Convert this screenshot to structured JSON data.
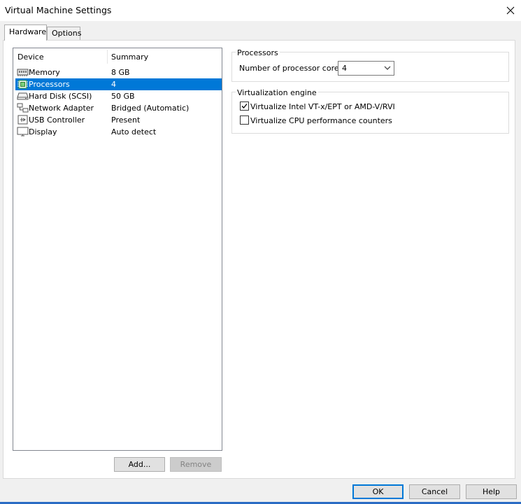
{
  "window": {
    "title": "Virtual Machine Settings"
  },
  "tabs": [
    {
      "label": "Hardware",
      "active": true
    },
    {
      "label": "Options",
      "active": false
    }
  ],
  "device_list": {
    "columns": [
      "Device",
      "Summary"
    ],
    "rows": [
      {
        "icon": "memory-icon",
        "device": "Memory",
        "summary": "8 GB",
        "selected": false
      },
      {
        "icon": "processor-icon",
        "device": "Processors",
        "summary": "4",
        "selected": true
      },
      {
        "icon": "hard-disk-icon",
        "device": "Hard Disk (SCSI)",
        "summary": "50 GB",
        "selected": false
      },
      {
        "icon": "network-adapter-icon",
        "device": "Network Adapter",
        "summary": "Bridged (Automatic)",
        "selected": false
      },
      {
        "icon": "usb-controller-icon",
        "device": "USB Controller",
        "summary": "Present",
        "selected": false
      },
      {
        "icon": "display-icon",
        "device": "Display",
        "summary": "Auto detect",
        "selected": false
      }
    ],
    "add_label": "Add...",
    "remove_label": "Remove"
  },
  "processors_group": {
    "title": "Processors",
    "cores_label": "Number of processor cores:",
    "cores_value": "4"
  },
  "virtualization_group": {
    "title": "Virtualization engine",
    "options": [
      {
        "label": "Virtualize Intel VT-x/EPT or AMD-V/RVI",
        "checked": true
      },
      {
        "label": "Virtualize CPU performance counters",
        "checked": false
      }
    ]
  },
  "footer": {
    "ok_label": "OK",
    "cancel_label": "Cancel",
    "help_label": "Help"
  },
  "colors": {
    "selection": "#0078d7",
    "accent": "#0078d7"
  }
}
